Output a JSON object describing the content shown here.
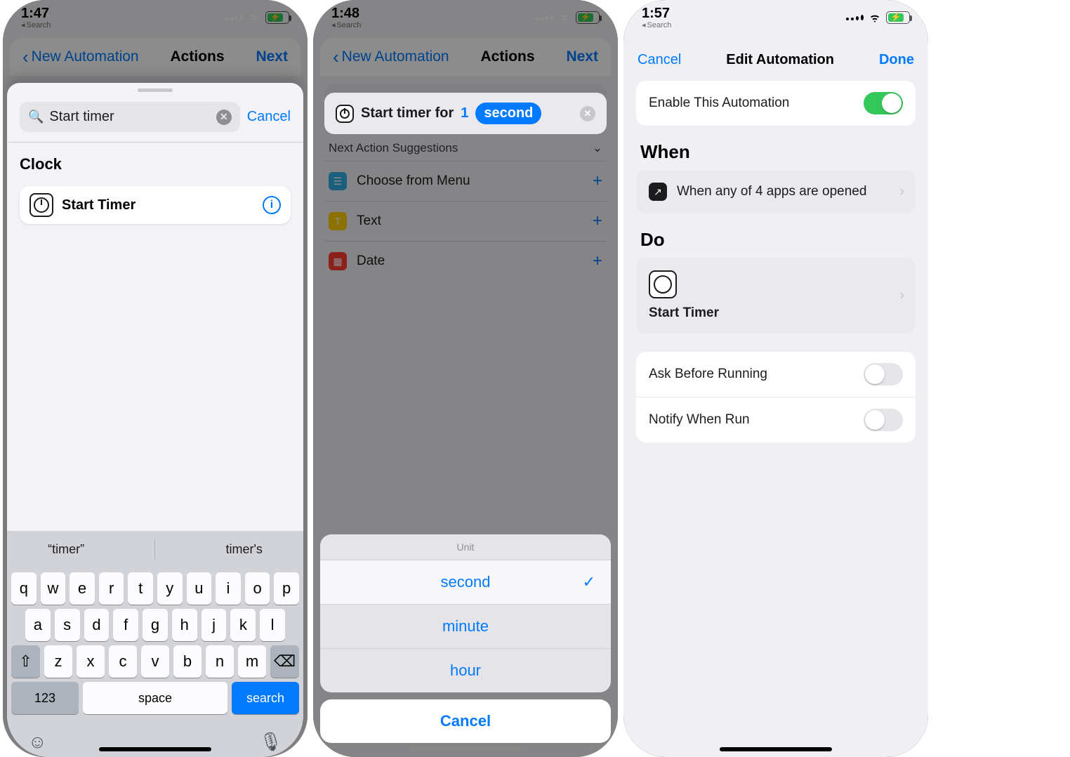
{
  "status": {
    "time1": "1:47",
    "time2": "1:48",
    "time3": "1:57",
    "back_search": "Search"
  },
  "nav": {
    "back_label": "New Automation",
    "title": "Actions",
    "next": "Next"
  },
  "panel1": {
    "search_value": "Start timer",
    "cancel": "Cancel",
    "section": "Clock",
    "result": "Start Timer",
    "predict1": "“timer”",
    "predict2": "timer's",
    "keys_row1": [
      "q",
      "w",
      "e",
      "r",
      "t",
      "y",
      "u",
      "i",
      "o",
      "p"
    ],
    "keys_row2": [
      "a",
      "s",
      "d",
      "f",
      "g",
      "h",
      "j",
      "k",
      "l"
    ],
    "keys_row3": [
      "z",
      "x",
      "c",
      "v",
      "b",
      "n",
      "m"
    ],
    "k_123": "123",
    "k_space": "space",
    "k_search": "search"
  },
  "panel2": {
    "action_prefix": "Start timer for",
    "action_value": "1",
    "action_unit": "second",
    "sugg_header": "Next Action Suggestions",
    "sugg1": "Choose from Menu",
    "sugg2": "Text",
    "sugg3": "Date",
    "picker_header": "Unit",
    "opt1": "second",
    "opt2": "minute",
    "opt3": "hour",
    "picker_cancel": "Cancel"
  },
  "panel3": {
    "nav_cancel": "Cancel",
    "nav_title": "Edit Automation",
    "nav_done": "Done",
    "enable_label": "Enable This Automation",
    "when": "When",
    "when_desc": "When any of 4 apps are opened",
    "do": "Do",
    "do_action": "Start Timer",
    "ask_label": "Ask Before Running",
    "notify_label": "Notify When Run"
  }
}
